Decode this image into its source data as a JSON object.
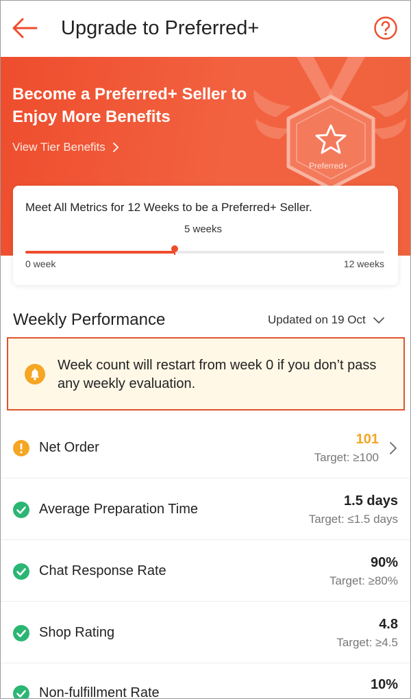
{
  "header": {
    "title": "Upgrade to Preferred+",
    "back_icon": "arrow-left-icon",
    "help_icon": "question-circle-icon"
  },
  "banner": {
    "title": "Become a Preferred+ Seller to Enjoy More Benefits",
    "link_label": "View Tier Benefits",
    "medal_label": "Preferred+",
    "color": "#ee4d2d"
  },
  "progress": {
    "title": "Meet All Metrics for 12 Weeks to be a Preferred+ Seller.",
    "current_label": "5 weeks",
    "current_weeks": 5,
    "total_weeks": 12,
    "start_label": "0 week",
    "end_label": "12 weeks"
  },
  "performance": {
    "title": "Weekly Performance",
    "updated_label": "Updated on 19 Oct",
    "notice": "Week count will restart from week 0 if you don’t pass any weekly evaluation."
  },
  "metrics": [
    {
      "name": "Net Order",
      "value": "101",
      "target": "Target: ≥100",
      "status": "warning"
    },
    {
      "name": "Average Preparation Time",
      "value": "1.5 days",
      "target": "Target: ≤1.5 days",
      "status": "pass"
    },
    {
      "name": "Chat Response Rate",
      "value": "90%",
      "target": "Target: ≥80%",
      "status": "pass"
    },
    {
      "name": "Shop Rating",
      "value": "4.8",
      "target": "Target: ≥4.5",
      "status": "pass"
    },
    {
      "name": "Non-fulfillment Rate",
      "value": "10%",
      "target": "",
      "status": "pass"
    }
  ],
  "colors": {
    "accent": "#ee4d2d",
    "warning": "#f5a623",
    "success": "#2bb673",
    "notice_bg": "#fff8e6"
  }
}
